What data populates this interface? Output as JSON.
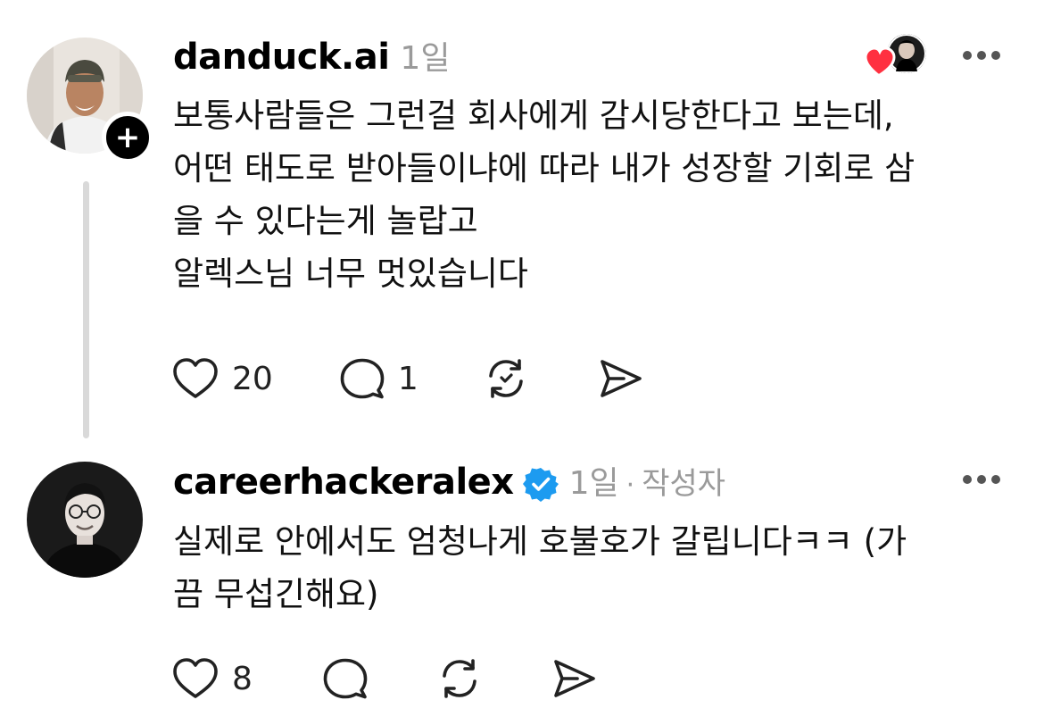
{
  "posts": [
    {
      "username": "danduck.ai",
      "time": "1일",
      "lines": [
        "보통사람들은 그런걸 회사에게 감시당한다고 보는데,",
        "어떤 태도로 받아들이냐에 따라 내가 성장할 기회로 삼",
        "을 수 있다는게 놀랍고",
        "알렉스님 너무 멋있습니다"
      ],
      "like_count": "20",
      "reply_count": "1",
      "follow_badge": "+"
    },
    {
      "username": "careerhackeralex",
      "time": "1일",
      "separator": "·",
      "author_tag": "작성자",
      "lines": [
        "실제로 안에서도 엄청나게 호불호가 갈립니다ㅋㅋ (가",
        "끔 무섭긴해요)"
      ],
      "like_count": "8"
    }
  ],
  "icons": {
    "like": "heart-icon",
    "reply": "comment-icon",
    "repost": "repost-icon",
    "share": "send-icon",
    "more": "more-icon",
    "verified": "verified-badge-icon",
    "liked_by": "liked-by-author-icon"
  },
  "colors": {
    "verified": "#1d9bf0",
    "liked_heart": "#ff3040",
    "thread_line": "#d9d9d9",
    "muted_text": "#9a9a9a"
  }
}
